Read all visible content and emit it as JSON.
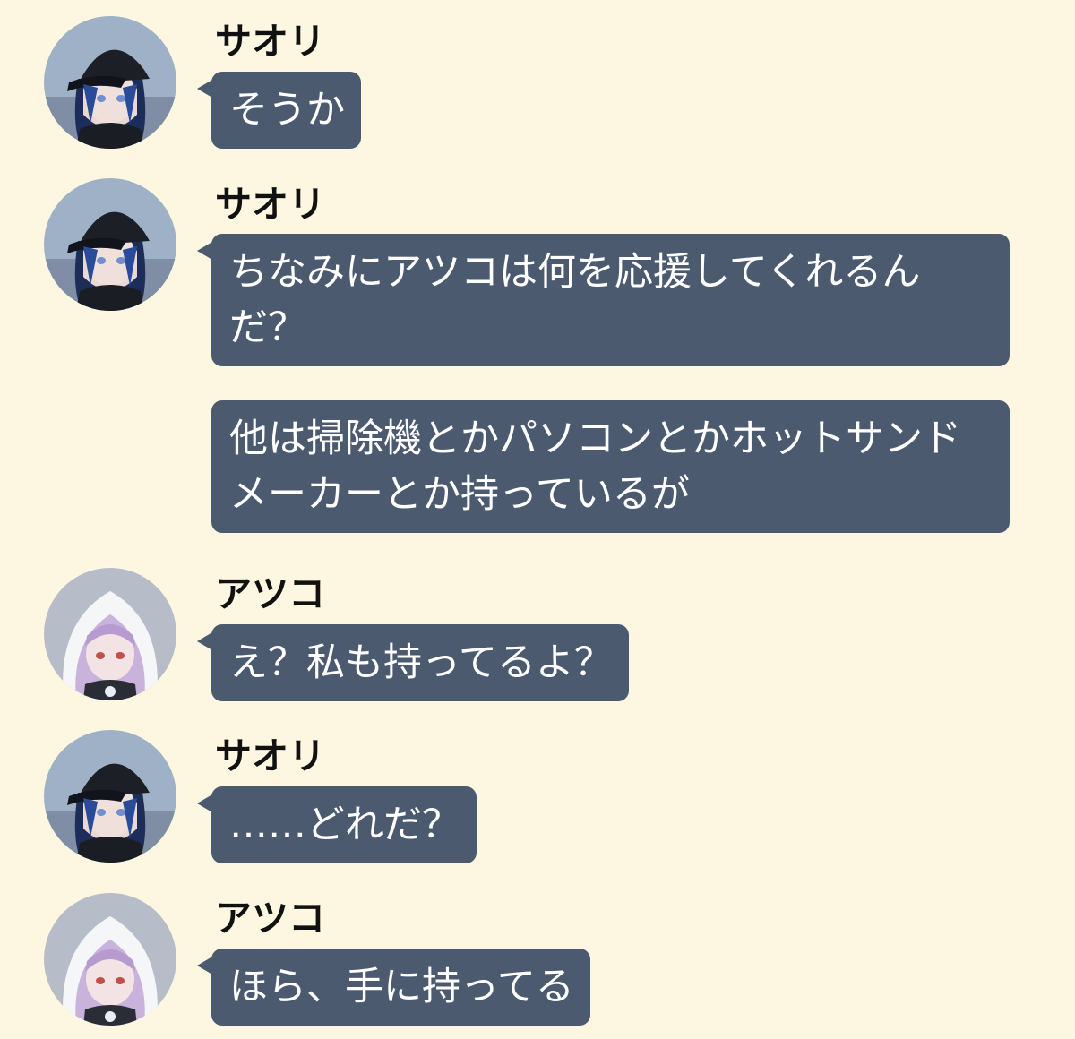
{
  "chat": {
    "messages": [
      {
        "sender": "サオリ",
        "avatar": "saori-avatar",
        "text": "そうか"
      },
      {
        "sender": "サオリ",
        "avatar": "saori-avatar",
        "text": "ちなみにアツコは何を応援してくれるんだ？"
      },
      {
        "sender": "",
        "avatar": "",
        "text": "他は掃除機とかパソコンとかホットサンドメーカーとか持っているが"
      },
      {
        "sender": "アツコ",
        "avatar": "atsuko-avatar",
        "text": "え？私も持ってるよ？"
      },
      {
        "sender": "サオリ",
        "avatar": "saori-avatar",
        "text": "……どれだ？"
      },
      {
        "sender": "アツコ",
        "avatar": "atsuko-avatar",
        "text": "ほら、手に持ってる"
      }
    ]
  },
  "colors": {
    "background": "#fdf7e1",
    "bubble": "#4c5a70",
    "bubble_text": "#ffffff",
    "sender_text": "#111111"
  }
}
